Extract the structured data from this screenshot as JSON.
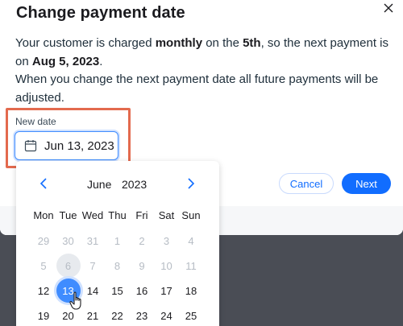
{
  "modal": {
    "title": "Change payment date",
    "description": {
      "p1_a": "Your customer is charged ",
      "p1_b": "monthly",
      "p1_c": " on the ",
      "p1_d": "5th",
      "p1_e": ", so the next payment is on ",
      "p1_f": "Aug 5, 2023",
      "p1_g": ".",
      "p2": "When you change the next payment date all future payments will be adjusted."
    },
    "field_label": "New date",
    "date_value": "Jun 13, 2023",
    "cancel_label": "Cancel",
    "next_label": "Next"
  },
  "calendar": {
    "month": "June",
    "year": "2023",
    "weekdays": [
      "Mon",
      "Tue",
      "Wed",
      "Thu",
      "Fri",
      "Sat",
      "Sun"
    ],
    "weeks": [
      [
        {
          "d": "29",
          "s": "muted"
        },
        {
          "d": "30",
          "s": "muted"
        },
        {
          "d": "31",
          "s": "muted"
        },
        {
          "d": "1",
          "s": "muted"
        },
        {
          "d": "2",
          "s": "muted"
        },
        {
          "d": "3",
          "s": "muted"
        },
        {
          "d": "4",
          "s": "muted"
        }
      ],
      [
        {
          "d": "5",
          "s": "muted"
        },
        {
          "d": "6",
          "s": "today"
        },
        {
          "d": "7",
          "s": "muted"
        },
        {
          "d": "8",
          "s": "muted"
        },
        {
          "d": "9",
          "s": "muted"
        },
        {
          "d": "10",
          "s": "muted"
        },
        {
          "d": "11",
          "s": "muted"
        }
      ],
      [
        {
          "d": "12",
          "s": ""
        },
        {
          "d": "13",
          "s": "selected"
        },
        {
          "d": "14",
          "s": ""
        },
        {
          "d": "15",
          "s": ""
        },
        {
          "d": "16",
          "s": ""
        },
        {
          "d": "17",
          "s": ""
        },
        {
          "d": "18",
          "s": ""
        }
      ],
      [
        {
          "d": "19",
          "s": ""
        },
        {
          "d": "20",
          "s": ""
        },
        {
          "d": "21",
          "s": ""
        },
        {
          "d": "22",
          "s": ""
        },
        {
          "d": "23",
          "s": ""
        },
        {
          "d": "24",
          "s": ""
        },
        {
          "d": "25",
          "s": ""
        }
      ]
    ]
  },
  "colors": {
    "accent": "#116dff",
    "highlight": "#e36a4e",
    "selected_day": "#3f8cff"
  }
}
